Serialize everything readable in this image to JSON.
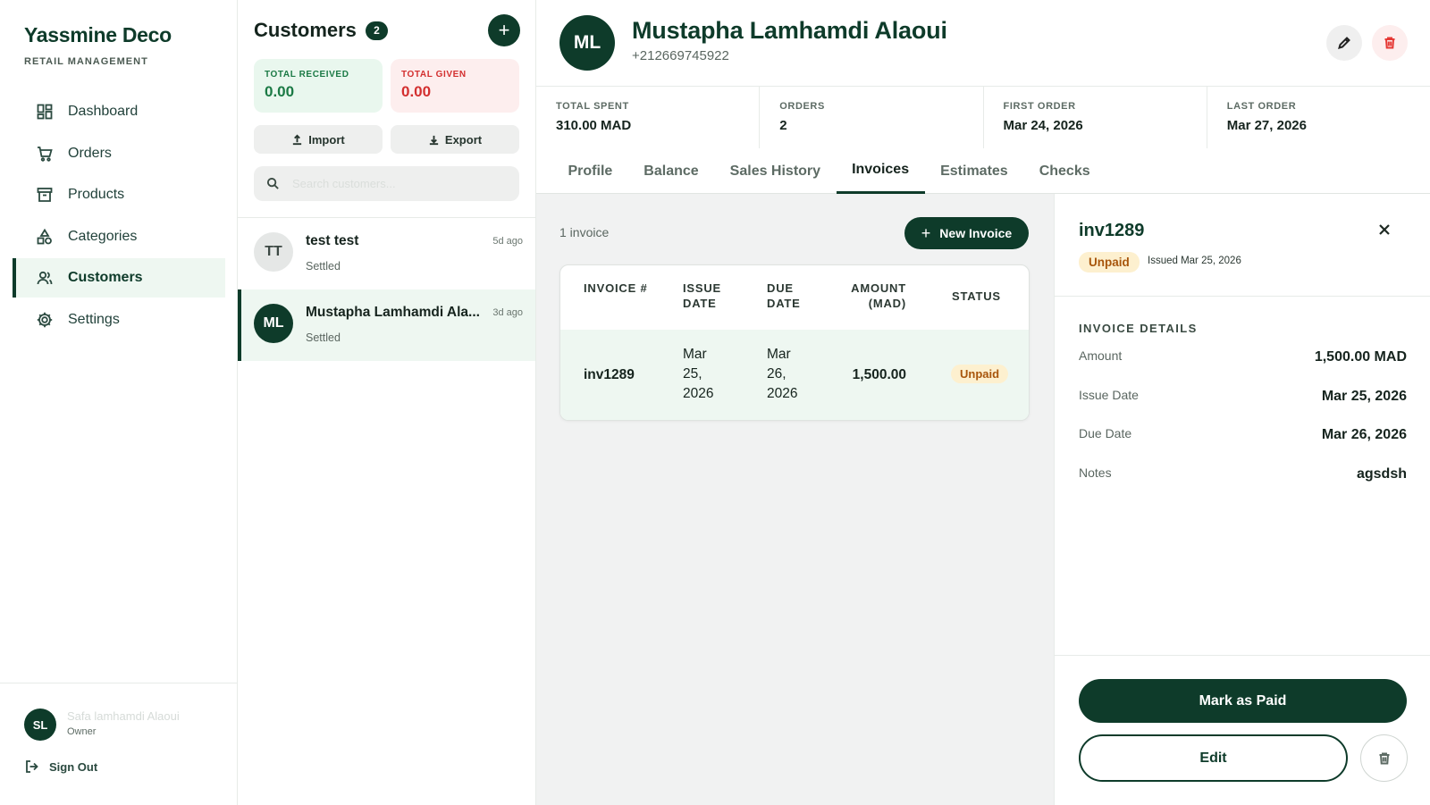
{
  "brand": {
    "name": "Yassmine Deco",
    "subtitle": "RETAIL MANAGEMENT"
  },
  "nav": [
    {
      "label": "Dashboard",
      "icon": "dashboard-icon"
    },
    {
      "label": "Orders",
      "icon": "cart-icon"
    },
    {
      "label": "Products",
      "icon": "archive-box-icon"
    },
    {
      "label": "Categories",
      "icon": "shapes-icon"
    },
    {
      "label": "Customers",
      "icon": "users-icon",
      "active": true
    },
    {
      "label": "Settings",
      "icon": "gear-icon"
    }
  ],
  "user": {
    "initials": "SL",
    "name": "Safa lamhamdi Alaoui",
    "role": "Owner",
    "signout": "Sign Out"
  },
  "customers_panel": {
    "title": "Customers",
    "count": "2",
    "add_label": "+",
    "total_received": {
      "label": "TOTAL RECEIVED",
      "value": "0.00"
    },
    "total_given": {
      "label": "TOTAL GIVEN",
      "value": "0.00"
    },
    "import_label": "Import",
    "export_label": "Export",
    "search_placeholder": "Search customers...",
    "items": [
      {
        "initials": "TT",
        "name": "test test",
        "time": "5d ago",
        "status": "Settled"
      },
      {
        "initials": "ML",
        "name": "Mustapha Lamhamdi Ala...",
        "time": "3d ago",
        "status": "Settled"
      }
    ]
  },
  "customer": {
    "initials": "ML",
    "name": "Mustapha Lamhamdi Alaoui",
    "phone": "+212669745922",
    "stats": [
      {
        "label": "TOTAL SPENT",
        "value": "310.00 MAD"
      },
      {
        "label": "ORDERS",
        "value": "2"
      },
      {
        "label": "FIRST ORDER",
        "value": "Mar 24, 2026"
      },
      {
        "label": "LAST ORDER",
        "value": "Mar 27, 2026"
      }
    ]
  },
  "tabs": [
    "Profile",
    "Balance",
    "Sales History",
    "Invoices",
    "Estimates",
    "Checks"
  ],
  "active_tab": "Invoices",
  "invoices": {
    "count_label": "1 invoice",
    "new_label": "New Invoice",
    "headers": {
      "number": "INVOICE #",
      "issue": "ISSUE DATE",
      "due": "DUE DATE",
      "amount": "AMOUNT (MAD)",
      "status": "STATUS"
    },
    "rows": [
      {
        "number": "inv1289",
        "issue_l1": "Mar",
        "issue_l2": "25,",
        "issue_l3": "2026",
        "due_l1": "Mar",
        "due_l2": "26,",
        "due_l3": "2026",
        "amount": "1,500.00",
        "status": "Unpaid"
      }
    ]
  },
  "invoice_detail": {
    "number": "inv1289",
    "status": "Unpaid",
    "issued": "Issued Mar 25, 2026",
    "section_title": "INVOICE DETAILS",
    "fields": [
      {
        "label": "Amount",
        "value": "1,500.00 MAD"
      },
      {
        "label": "Issue Date",
        "value": "Mar 25, 2026"
      },
      {
        "label": "Due Date",
        "value": "Mar 26, 2026"
      },
      {
        "label": "Notes",
        "value": "agsdsh"
      }
    ],
    "mark_paid_label": "Mark as Paid",
    "edit_label": "Edit"
  },
  "colors": {
    "brand_dark": "#0e3b2a",
    "received": "#1b7a45",
    "given": "#d32f2f",
    "unpaid_bg": "#fdf0cf",
    "unpaid_fg": "#a8560c"
  }
}
